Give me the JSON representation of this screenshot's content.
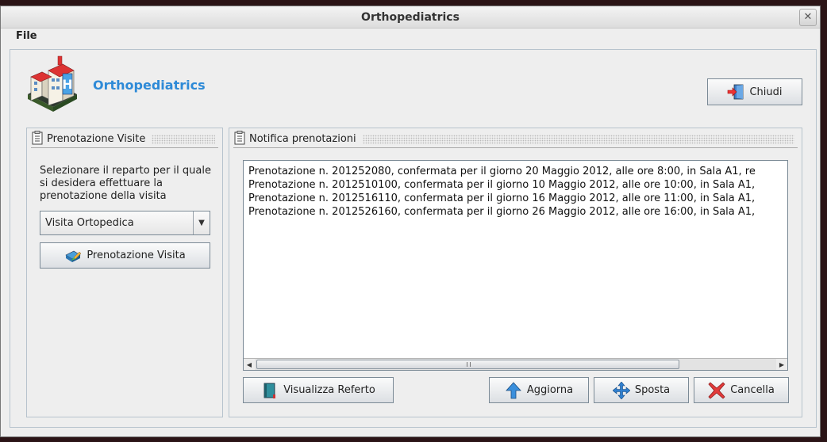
{
  "window": {
    "title": "Orthopediatrics"
  },
  "menu": {
    "file": "File"
  },
  "header": {
    "app_name": "Orthopediatrics",
    "close_button": "Chiudi"
  },
  "left_panel": {
    "title": "Prenotazione Visite",
    "instructions": "Selezionare il reparto per il quale si desidera effettuare la prenotazione della visita",
    "department_select": {
      "selected": "Visita Ortopedica"
    },
    "book_button": "Prenotazione Visita"
  },
  "right_panel": {
    "title": "Notifica prenotazioni",
    "notifications": [
      "Prenotazione n. 201252080, confermata per il giorno 20 Maggio 2012, alle ore 8:00, in Sala A1, re",
      "Prenotazione n. 2012510100, confermata per il giorno 10 Maggio 2012, alle ore 10:00, in Sala A1,",
      "Prenotazione n. 2012516110, confermata per il giorno 16 Maggio 2012, alle ore 11:00, in Sala A1,",
      "Prenotazione n. 2012526160, confermata per il giorno 26 Maggio 2012, alle ore 16:00, in Sala A1,"
    ],
    "buttons": {
      "view_report": "Visualizza Referto",
      "refresh": "Aggiorna",
      "move": "Sposta",
      "cancel": "Cancella"
    }
  },
  "colors": {
    "accent": "#2e8ad7",
    "window_bg": "#eeeeee",
    "desktop_bg": "#2b1416"
  },
  "icons": {
    "logo": "hospital-building-icon",
    "close": "exit-door-icon",
    "book": "calendar-pen-icon",
    "report": "book-icon",
    "refresh": "arrow-up-icon",
    "move": "move-arrows-icon",
    "cancel": "red-x-icon"
  }
}
